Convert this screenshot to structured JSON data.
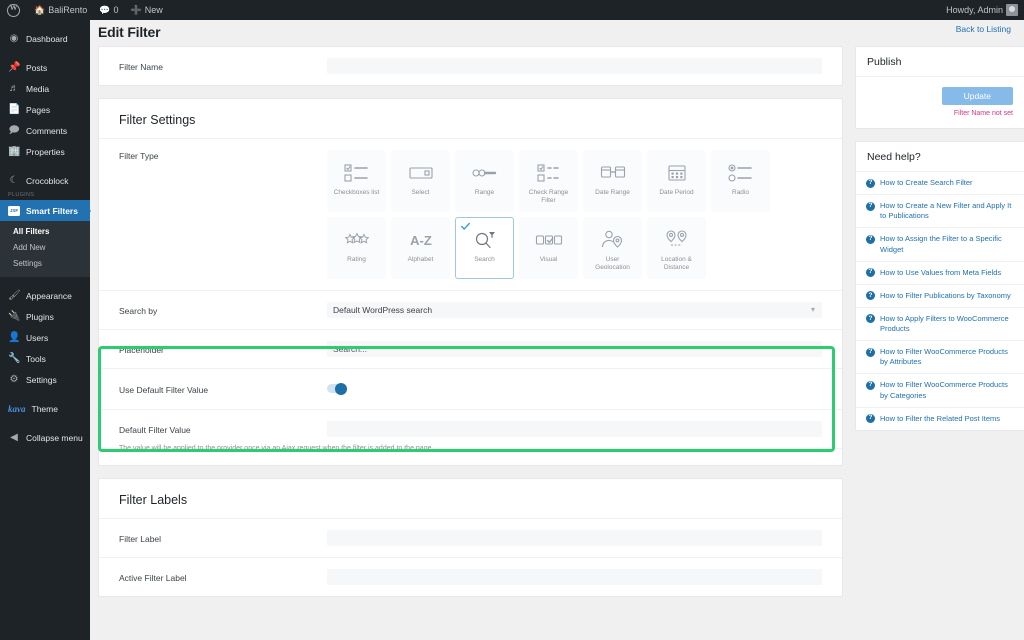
{
  "adminbar": {
    "wp_logo": "wordpress-logo",
    "site_name": "BaliRento",
    "comments_count": "0",
    "new_label": "New",
    "howdy": "Howdy, Admin"
  },
  "sidebar": {
    "items": [
      {
        "label": "Dashboard",
        "icon": "dashboard-icon"
      },
      {
        "label": "Posts",
        "icon": "pin-icon"
      },
      {
        "label": "Media",
        "icon": "media-icon"
      },
      {
        "label": "Pages",
        "icon": "page-icon"
      },
      {
        "label": "Comments",
        "icon": "comment-icon"
      },
      {
        "label": "Properties",
        "icon": "building-icon"
      },
      {
        "label": "Crocoblock",
        "icon": "crocoblock-icon"
      }
    ],
    "group_label": "Plugins",
    "active_item": {
      "label": "Smart Filters",
      "icon": "smart-filters-icon",
      "badge": "JSF"
    },
    "submenu": [
      {
        "label": "All Filters",
        "current": true
      },
      {
        "label": "Add New",
        "current": false
      },
      {
        "label": "Settings",
        "current": false
      }
    ],
    "items_bottom": [
      {
        "label": "Appearance",
        "icon": "brush-icon"
      },
      {
        "label": "Plugins",
        "icon": "plug-icon"
      },
      {
        "label": "Users",
        "icon": "users-icon"
      },
      {
        "label": "Tools",
        "icon": "wrench-icon"
      },
      {
        "label": "Settings",
        "icon": "settings-icon"
      }
    ],
    "theme": {
      "logo": "kava",
      "label": "Theme"
    },
    "collapse": {
      "label": "Collapse menu",
      "icon": "collapse-icon"
    }
  },
  "page": {
    "title": "Edit Filter",
    "back_link": "Back to Listing"
  },
  "filter_name": {
    "label": "Filter Name",
    "value": "",
    "placeholder": ""
  },
  "filter_settings": {
    "title": "Filter Settings",
    "filter_type_label": "Filter Type",
    "types": [
      {
        "label": "Checkboxes list",
        "icon": "checkbox-list-icon",
        "selected": false
      },
      {
        "label": "Select",
        "icon": "select-box-icon",
        "selected": false
      },
      {
        "label": "Range",
        "icon": "range-slider-icon",
        "selected": false
      },
      {
        "label": "Check Range Filter",
        "icon": "check-range-icon",
        "selected": false
      },
      {
        "label": "Date Range",
        "icon": "date-range-icon",
        "selected": false
      },
      {
        "label": "Date Period",
        "icon": "calendar-icon",
        "selected": false
      },
      {
        "label": "Radio",
        "icon": "radio-list-icon",
        "selected": false
      },
      {
        "label": "Rating",
        "icon": "stars-icon",
        "selected": false
      },
      {
        "label": "Alphabet",
        "icon": "a-to-z-icon",
        "selected": false
      },
      {
        "label": "Search",
        "icon": "search-funnel-icon",
        "selected": true
      },
      {
        "label": "Visual",
        "icon": "visual-swatch-icon",
        "selected": false
      },
      {
        "label": "User Geolocation",
        "icon": "user-geolocation-icon",
        "selected": false
      },
      {
        "label": "Location & Distance",
        "icon": "location-distance-icon",
        "selected": false
      }
    ],
    "search_by": {
      "label": "Search by",
      "value": "Default WordPress search"
    },
    "placeholder_field": {
      "label": "Placeholder",
      "value": "Search..."
    },
    "use_default_value": {
      "label": "Use Default Filter Value",
      "enabled": true
    },
    "default_value": {
      "label": "Default Filter Value",
      "value": "",
      "help": "The value will be applied to the provider once via an Ajax request when the filter is added to the page"
    }
  },
  "filter_labels": {
    "title": "Filter Labels",
    "filter_label": {
      "label": "Filter Label",
      "value": ""
    },
    "active_filter_label": {
      "label": "Active Filter Label",
      "value": ""
    }
  },
  "publish": {
    "title": "Publish",
    "update_label": "Update",
    "notice": "Filter Name not set"
  },
  "help": {
    "title": "Need help?",
    "links": [
      "How to Create Search Filter",
      "How to Create a New Filter and Apply It to Publications",
      "How to Assign the Filter to a Specific Widget",
      "How to Use Values from Meta Fields",
      "How to Filter Publications by Taxonomy",
      "How to Apply Filters to WooCommerce Products",
      "How to Filter WooCommerce Products by Attributes",
      "How to Filter WooCommerce Products by Categories",
      "How to Filter the Related Post Items"
    ]
  },
  "colors": {
    "accent": "#2271b1",
    "highlight": "#2ecc71",
    "notice": "#d63384",
    "sidebar_bg": "#1d2327"
  }
}
